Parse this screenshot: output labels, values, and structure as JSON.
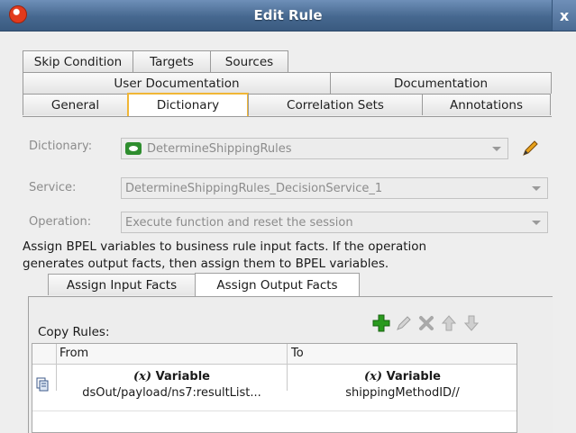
{
  "window": {
    "title": "Edit Rule",
    "close_label": "x"
  },
  "tabs": {
    "row1": [
      "Skip Condition",
      "Targets",
      "Sources"
    ],
    "row2": [
      "User Documentation",
      "Documentation"
    ],
    "row3": [
      "General",
      "Dictionary",
      "Correlation Sets",
      "Annotations"
    ],
    "selected": "Dictionary"
  },
  "form": {
    "dictionary_label": "Dictionary:",
    "dictionary_value": "DetermineShippingRules",
    "service_label": "Service:",
    "service_value": "DetermineShippingRules_DecisionService_1",
    "operation_label": "Operation:",
    "operation_value": "Execute function and reset the session"
  },
  "description": {
    "line1": "Assign BPEL variables to business rule input facts. If the operation",
    "line2": "generates output facts, then assign them to BPEL variables."
  },
  "subtabs": {
    "input": "Assign Input Facts",
    "output": "Assign Output Facts",
    "selected": "Assign Output Facts"
  },
  "copy_rules": {
    "label": "Copy Rules:",
    "toolbar_icons": [
      "add-icon",
      "edit-icon",
      "delete-icon",
      "move-up-icon",
      "move-down-icon"
    ],
    "columns": [
      "From",
      "To"
    ],
    "rows": [
      {
        "from_type": "Variable",
        "from_value": "dsOut/payload/ns7:resultList...",
        "to_type": "Variable",
        "to_value": "shippingMethodID//"
      }
    ]
  },
  "colors": {
    "title_bar": "#46688f",
    "selected_tab_border": "#f0b636",
    "add_icon": "#2a9a1e"
  }
}
